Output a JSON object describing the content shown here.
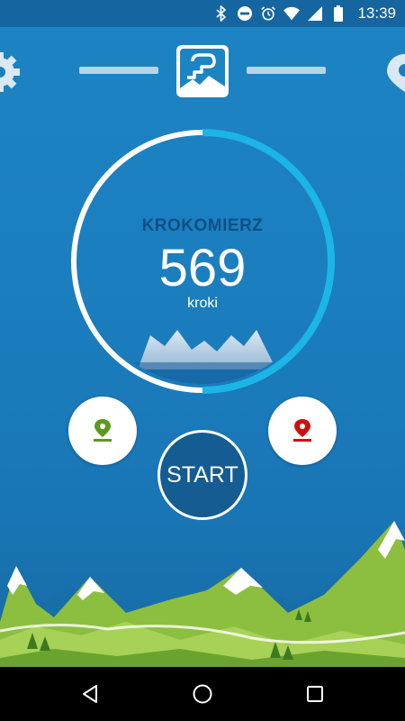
{
  "status_bar": {
    "time": "13:39",
    "icons": [
      "bluetooth-icon",
      "do-not-disturb-icon",
      "alarm-icon",
      "wifi-icon",
      "cellular-signal-icon",
      "battery-icon"
    ]
  },
  "header": {
    "left_icon": "gear-icon",
    "right_icon": "location-pin-icon",
    "logo_icon": "step-counter-logo-icon"
  },
  "gauge": {
    "title": "KROKOMIERZ",
    "value": "569",
    "unit": "kroki",
    "progress": 0.5
  },
  "actions": {
    "start_pin_icon": "green-location-pin-icon",
    "end_pin_icon": "red-location-pin-icon",
    "start_label": "START"
  },
  "navigation": {
    "back_icon": "back-triangle-icon",
    "home_icon": "home-circle-icon",
    "recents_icon": "recents-square-icon"
  },
  "colors": {
    "background": "#1b7fbf",
    "gauge_progress": "#1bb5e8",
    "gauge_title": "#0d4f86",
    "start_pin": "#5b9a1f",
    "end_pin": "#d10f0f",
    "mountain_green": "#8cbf3f"
  }
}
